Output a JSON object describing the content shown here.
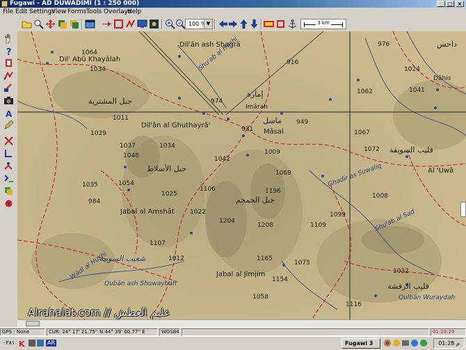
{
  "window": {
    "title": "Fugawi - AD DUWADIMI  (1 : 250 000)"
  },
  "menu": [
    "File",
    "Edit",
    "Settings",
    "View",
    "Forms",
    "Tools",
    "Overlays",
    "Help"
  ],
  "toolbar": {
    "zoom_value": "100 %",
    "scale_label": "3 km"
  },
  "map": {
    "labels": {
      "n1064": "1064",
      "dil_abu": "Dil' Abū Khayālah",
      "n1034a": "1034",
      "dil_shagra": "Dil'ān ash Shagrā",
      "shuab_hushi": "Shu'ab al Hushi",
      "n916": "916",
      "n976": "976",
      "n1024": "1024",
      "n1062": "1062",
      "n1041": "1041",
      "dahis": "Dāhis",
      "dahis_ar": "داحس",
      "ar_top": "جبل المشترية",
      "n974": "974",
      "imarah_ar": "إمارة",
      "imarah": "Imārah",
      "masal_ar": "ماسل",
      "masal": "Māsal",
      "n949": "949",
      "n931": "931",
      "n1011": "1011",
      "dil_ghuthayra": "Dil'ān al Ghuthayrā'",
      "n1029": "1029",
      "n1037": "1037",
      "n1034b": "1034",
      "n1048": "1048",
      "n1009": "1009",
      "n1067": "1067",
      "n1072": "1072",
      "ar_qasim": "قليب السويقة",
      "al_uwa": "Al 'Uwā",
      "n1042": "1042",
      "n1069": "1069",
      "ar_jabal1": "جبل الأسلاط",
      "ghadir": "Ghadir as Suwaliq",
      "n1035": "1035",
      "n1054": "1054",
      "n1106": "1106",
      "n1196": "1196",
      "n1008": "1008",
      "n1025": "1025",
      "ar_jamjam": "جبل الجمجم",
      "n984": "984",
      "n1099": "1099",
      "shuab_sad": "Shu'ab al Sad",
      "n1022": "1022",
      "n1204": "1204",
      "n1208": "1208",
      "n1109": "1109",
      "jabal_amshat": "Jabal al Amshāt",
      "n1107": "1107",
      "ar_wadi": "شعيب السويبة",
      "n1012": "1012",
      "n1165": "1165",
      "n1075": "1075",
      "n1032": "1032",
      "wadi_hushi": "Wādi al Hushi",
      "jabal_jimjim": "Jabal al Jimjim",
      "n1154": "1154",
      "quban": "Qubān ash Shuwaybah",
      "ar_bottom": "قليب الرفشة",
      "qulban": "Qulbān Wuraydah",
      "n1058": "1058",
      "n1116": "1116"
    },
    "watermark": "عليم العطش // Alrahalat.com"
  },
  "status": {
    "gps": "GPS : None",
    "cur": "CUR: 24° 17' 21.75'' N 44° 39' 00.77'' E",
    "datum": "WGS84",
    "time_right": "01:28:29"
  },
  "taskbar": {
    "lang": "AR",
    "app_button": "Fugawi 3",
    "clock": "01:28 م",
    "left_text": "٠٢٨١"
  },
  "colors": {
    "titlebar": "#0a246a",
    "map_base": "#c8b88a",
    "contour_red": "#c0283c",
    "wadi_blue": "#3d4a8c",
    "grid_dark": "#3b3b3b"
  }
}
